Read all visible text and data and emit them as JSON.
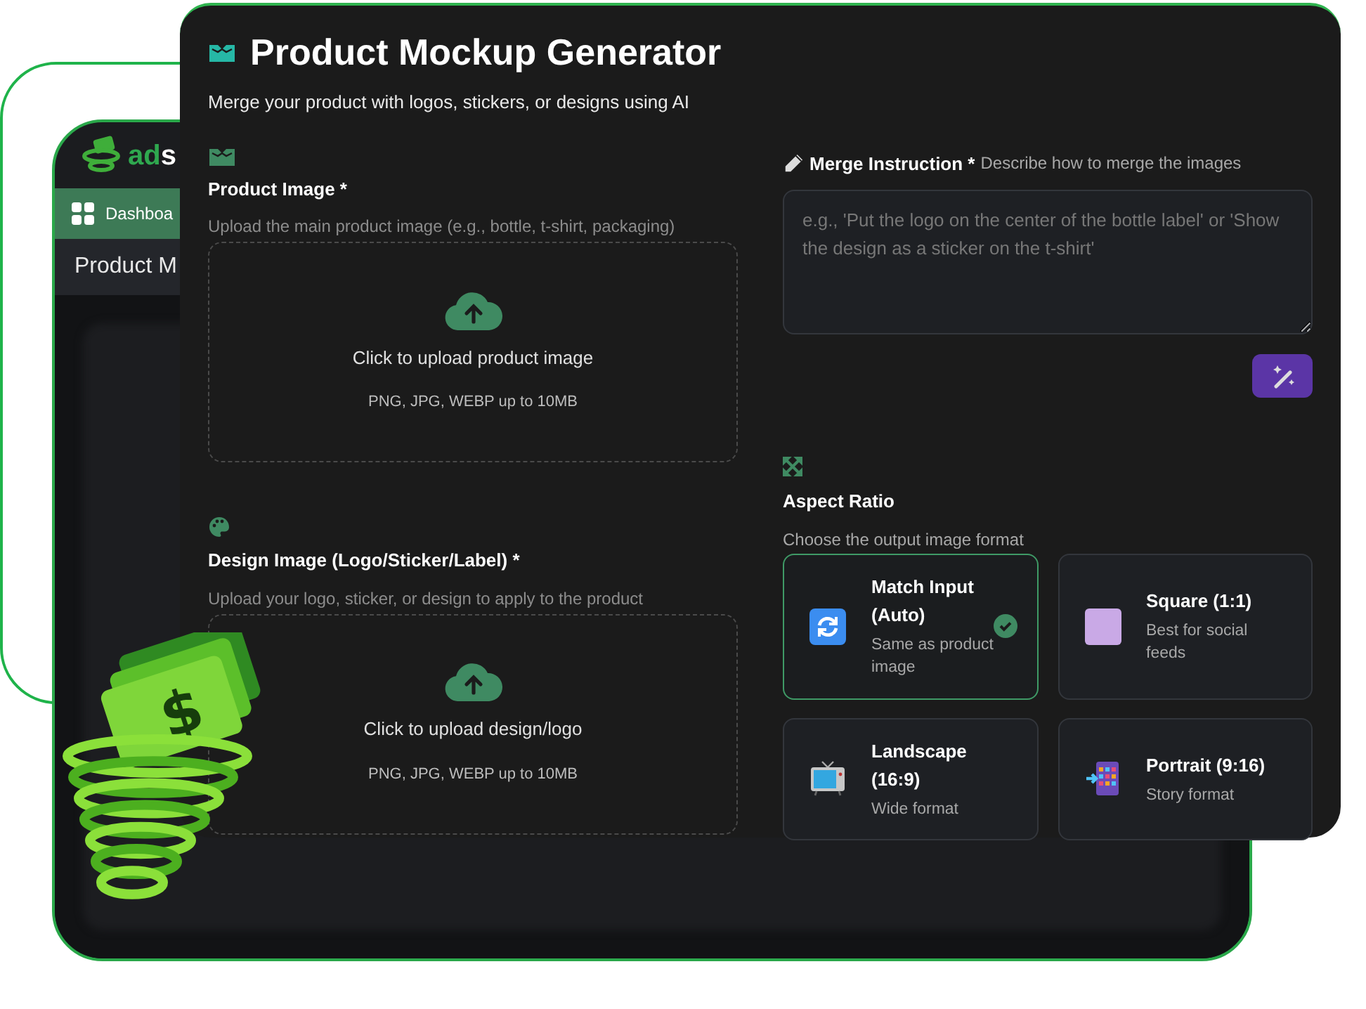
{
  "backdrop_app": {
    "logo_accent": "ad",
    "logo_rest": "s",
    "nav_item": "Dashboa",
    "page_title": "Product M"
  },
  "mascot": {
    "symbol": "$"
  },
  "header": {
    "title": "Product Mockup Generator",
    "subtitle": "Merge your product with logos, stickers, or designs using AI"
  },
  "uploads": [
    {
      "kind": "box",
      "label": "Product Image *",
      "hint": "Upload the main product image (e.g., bottle, t-shirt, packaging)",
      "prompt": "Click to upload product image",
      "formats": "PNG, JPG, WEBP up to 10MB"
    },
    {
      "kind": "palette",
      "label": "Design Image (Logo/Sticker/Label) *",
      "hint": "Upload your logo, sticker, or design to apply to the product",
      "prompt": "Click to upload design/logo",
      "formats": "PNG, JPG, WEBP up to 10MB"
    }
  ],
  "merge_instruction": {
    "label": "Merge Instruction *",
    "hint": "Describe how to merge the images",
    "placeholder": "e.g., 'Put the logo on the center of the bottle label' or 'Show the design as a sticker on the t-shirt'"
  },
  "aspect_ratio": {
    "label": "Aspect Ratio",
    "hint": "Choose the output image format",
    "options": [
      {
        "kind": "sync",
        "title": "Match Input (Auto)",
        "description": "Same as product image",
        "selected": true
      },
      {
        "kind": "square",
        "title": "Square (1:1)",
        "description": "Best for social feeds",
        "selected": false
      },
      {
        "kind": "tv",
        "title": "Landscape (16:9)",
        "description": "Wide format",
        "selected": false
      },
      {
        "kind": "phone",
        "title": "Portrait (9:16)",
        "description": "Story format",
        "selected": false
      }
    ]
  }
}
